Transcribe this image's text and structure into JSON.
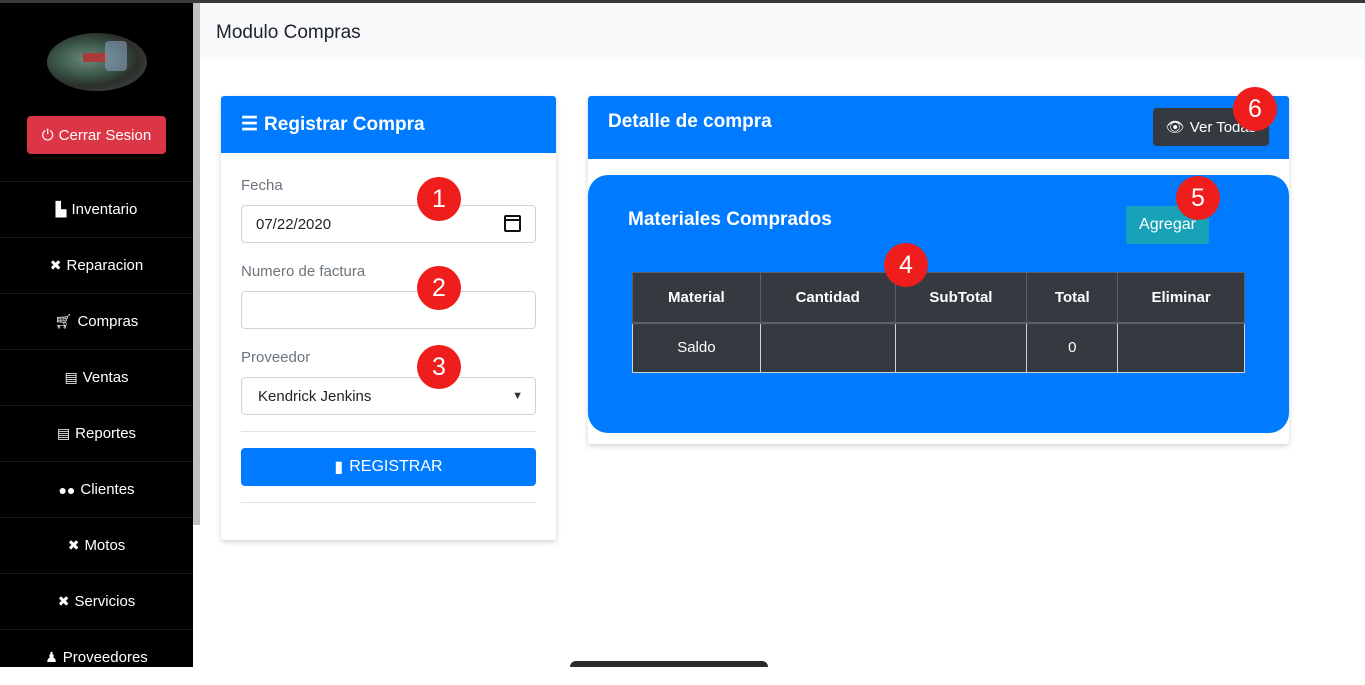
{
  "sidebar": {
    "logout_label": "Cerrar Sesion",
    "items": [
      {
        "label": "Inventario",
        "icon": "warehouse-icon"
      },
      {
        "label": "Reparacion",
        "icon": "tools-icon"
      },
      {
        "label": "Compras",
        "icon": "cart-icon"
      },
      {
        "label": "Ventas",
        "icon": "cash-register-icon"
      },
      {
        "label": "Reportes",
        "icon": "cash-register-icon"
      },
      {
        "label": "Clientes",
        "icon": "users-icon"
      },
      {
        "label": "Motos",
        "icon": "tools-icon"
      },
      {
        "label": "Servicios",
        "icon": "tools-icon"
      },
      {
        "label": "Proveedores",
        "icon": "user-tie-icon"
      }
    ]
  },
  "header": {
    "title": "Modulo Compras"
  },
  "register_form": {
    "title": "Registrar Compra",
    "fecha_label": "Fecha",
    "fecha_value": "07/22/2020",
    "factura_label": "Numero de factura",
    "factura_value": "",
    "proveedor_label": "Proveedor",
    "proveedor_value": "Kendrick Jenkins",
    "submit_label": "REGISTRAR"
  },
  "detail": {
    "title": "Detalle de compra",
    "ver_todas_label": "Ver Todas",
    "materials_title": "Materiales Comprados",
    "add_label": "Agregar",
    "table": {
      "headers": [
        "Material",
        "Cantidad",
        "SubTotal",
        "Total",
        "Eliminar"
      ],
      "rows": [
        [
          "Saldo",
          "",
          "",
          "0",
          ""
        ]
      ]
    }
  },
  "markers": [
    "1",
    "2",
    "3",
    "4",
    "5",
    "6"
  ],
  "colors": {
    "primary": "#007bff",
    "danger": "#dc3545",
    "info": "#17a2b8",
    "dark": "#343a40",
    "marker": "#f01d1d"
  }
}
